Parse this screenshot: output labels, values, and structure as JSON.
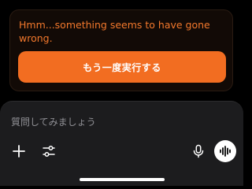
{
  "error": {
    "message": "Hmm...something seems to have gone wrong.",
    "retry_label": "もう一度実行する"
  },
  "composer": {
    "placeholder": "質問してみましょう",
    "icons": {
      "add": "plus-icon",
      "tools": "sliders-icon",
      "mic": "microphone-icon",
      "voice": "voice-waveform-icon"
    }
  },
  "colors": {
    "accent": "#f26d21",
    "error_text": "#f2782c",
    "card_bg": "#120a06",
    "composer_bg": "#1c1c1e"
  }
}
